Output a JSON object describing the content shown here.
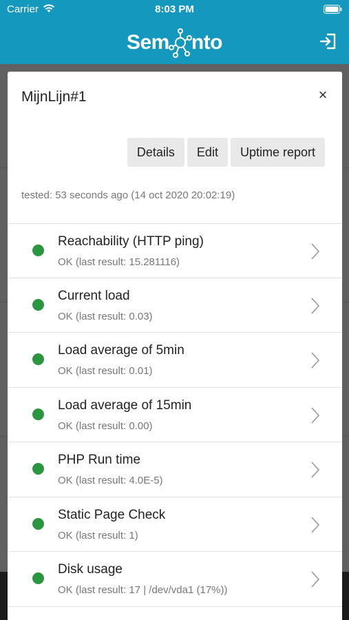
{
  "status_bar": {
    "carrier": "Carrier",
    "time": "8:03 PM"
  },
  "header": {
    "logo_left": "Sem",
    "logo_right": "nto"
  },
  "modal": {
    "title": "MijnLijn#1",
    "close": "×",
    "buttons": {
      "details": "Details",
      "edit": "Edit",
      "uptime": "Uptime report"
    },
    "tested": "tested: 53 seconds ago (14 oct 2020 20:02:19)",
    "checks": [
      {
        "name": "Reachability (HTTP ping)",
        "result": "OK (last result: 15.281116)",
        "status_color": "#2a9640"
      },
      {
        "name": "Current load",
        "result": "OK (last result: 0.03)",
        "status_color": "#2a9640"
      },
      {
        "name": "Load average of 5min",
        "result": "OK (last result: 0.01)",
        "status_color": "#2a9640"
      },
      {
        "name": "Load average of 15min",
        "result": "OK (last result: 0.00)",
        "status_color": "#2a9640"
      },
      {
        "name": "PHP Run time",
        "result": "OK (last result: 4.0E-5)",
        "status_color": "#2a9640"
      },
      {
        "name": "Static Page Check",
        "result": "OK (last result: 1)",
        "status_color": "#2a9640"
      },
      {
        "name": "Disk usage",
        "result": "OK (last result: 17 | /dev/vda1 (17%))",
        "status_color": "#2a9640"
      }
    ]
  },
  "colors": {
    "brand": "#1598bd",
    "ok": "#2a9640"
  }
}
